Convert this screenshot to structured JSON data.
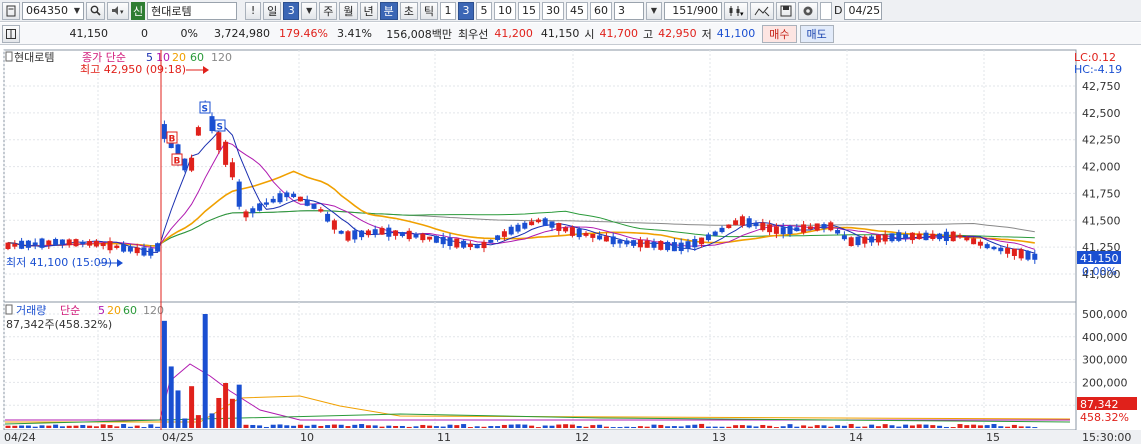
{
  "toolbar": {
    "code": "064350",
    "tag": "신",
    "name": "현대로템",
    "excl": "!",
    "period_day": "일",
    "period_num": "3",
    "week": "주",
    "month": "월",
    "year": "년",
    "minute": "분",
    "second": "초",
    "tick": "틱",
    "intervals": [
      "1",
      "3",
      "5",
      "10",
      "15",
      "30",
      "45",
      "60"
    ],
    "count_value": "3",
    "bars": "151",
    "bars_max": "/900",
    "d_label": "D",
    "date": "04/25",
    "icons": [
      "calculator-icon",
      "search-icon",
      "speaker-icon",
      "bar-chart-icon",
      "cross-icon",
      "save-icon",
      "gear-icon"
    ]
  },
  "infobar": {
    "price": "41,150",
    "change": "0",
    "change_pct": "0%",
    "volume": "3,724,980",
    "vol_ratio": "179.46%",
    "turnover_pct": "3.41%",
    "amount": "156,008백만",
    "best_label": "최우선",
    "best_ask": "41,200",
    "best_bid": "41,150",
    "open_label": "시",
    "open": "41,700",
    "high_label": "고",
    "high": "42,950",
    "low_label": "저",
    "low": "41,100",
    "buy": "매수",
    "sell": "매도"
  },
  "price_panel": {
    "name": "현대로템",
    "legend_prefix": "종가 단순",
    "ma": [
      "5",
      "10",
      "20",
      "60",
      "120"
    ],
    "high_note": "최고 42,950 (09:18)",
    "low_note": "최저 41,100 (15:09)",
    "lc": "LC:0.12",
    "hc": "HC:-4.19",
    "axis": [
      "42,750",
      "42,500",
      "42,250",
      "42,000",
      "41,750",
      "41,500",
      "41,250",
      "41,000"
    ],
    "current_price": "41,150",
    "current_pct": "0.00%"
  },
  "volume_panel": {
    "legend_label": "거래량",
    "legend_prefix": "단순",
    "ma": [
      "5",
      "20",
      "60",
      "120"
    ],
    "note": "87,342주(458.32%)",
    "axis": [
      "500,000",
      "400,000",
      "300,000",
      "200,000",
      "100,000"
    ],
    "current_vol": "87,342",
    "current_pct": "458.32%"
  },
  "x_axis": [
    "04/24",
    "15",
    "04/25",
    "10",
    "11",
    "12",
    "13",
    "14",
    "15",
    "15:30:00"
  ],
  "colors": {
    "up": "#e0211b",
    "down": "#1a4fd1",
    "ma5": "#1a2fb0",
    "ma10": "#b01ab0",
    "ma20": "#f0a000",
    "ma60": "#2a9a3a",
    "ma120": "#888888"
  },
  "chart_data": {
    "type": "candlestick",
    "price_axis": {
      "min": 41000,
      "max": 42750,
      "ticks": [
        42750,
        42500,
        42250,
        42000,
        41750,
        41500,
        41250,
        41000
      ]
    },
    "high": 42950,
    "high_time": "09:18",
    "low": 41100,
    "low_time": "15:09",
    "volume_axis": {
      "ticks": [
        500000,
        400000,
        300000,
        200000,
        100000
      ]
    },
    "last_volume": 87342
  }
}
